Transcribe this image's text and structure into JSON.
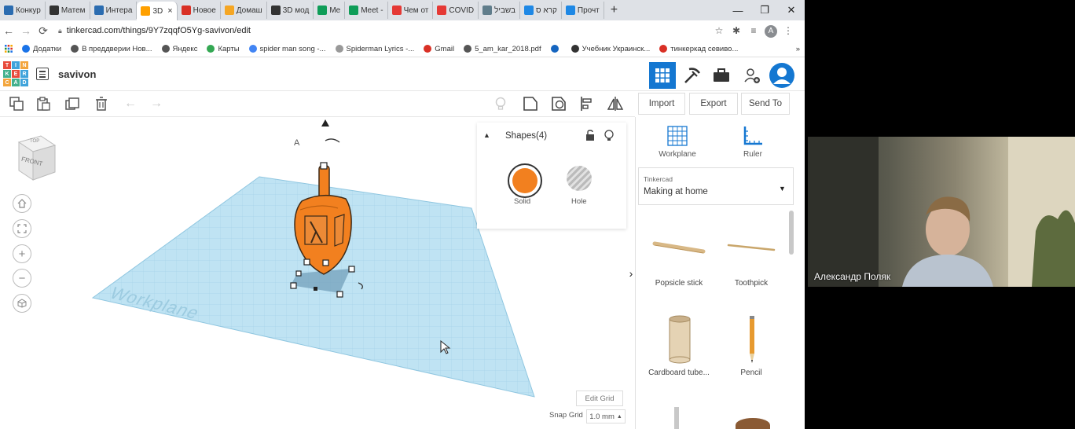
{
  "browser": {
    "tabs": [
      {
        "label": "Конкур",
        "icon_color": "#2b6cb0"
      },
      {
        "label": "Матем",
        "icon_color": "#333333"
      },
      {
        "label": "Интера",
        "icon_color": "#2b6cb0"
      },
      {
        "label": "3D",
        "icon_color": "#ffa000",
        "active": true
      },
      {
        "label": "Новое",
        "icon_color": "#d93025"
      },
      {
        "label": "Домаш",
        "icon_color": "#f5a623"
      },
      {
        "label": "3D мод",
        "icon_color": "#333333"
      },
      {
        "label": "Me",
        "icon_color": "#0f9d58"
      },
      {
        "label": "Meet -",
        "icon_color": "#0f9d58"
      },
      {
        "label": "Чем от",
        "icon_color": "#e53935"
      },
      {
        "label": "COVID",
        "icon_color": "#e53935"
      },
      {
        "label": "בשביל",
        "icon_color": "#607d8b"
      },
      {
        "label": "קרא ס",
        "icon_color": "#1e88e5"
      },
      {
        "label": "Прочт",
        "icon_color": "#1e88e5"
      }
    ],
    "new_tab": "+",
    "close_tab": "×",
    "url": "tinkercad.com/things/9Y7zqqfO5Yg-savivon/edit",
    "profile_initial": "A",
    "bookmarks": [
      {
        "label": "Додатки",
        "icon_color": "#1a73e8"
      },
      {
        "label": "В преддверии Нов...",
        "icon_color": "#555555"
      },
      {
        "label": "Яндекс",
        "icon_color": "#555555"
      },
      {
        "label": "Карты",
        "icon_color": "#34a853"
      },
      {
        "label": "spider man song -...",
        "icon_color": "#4285f4"
      },
      {
        "label": "Spiderman Lyrics -...",
        "icon_color": "#999999"
      },
      {
        "label": "Gmail",
        "icon_color": "#d93025"
      },
      {
        "label": "5_am_kar_2018.pdf",
        "icon_color": "#555555"
      },
      {
        "label": "",
        "icon_color": "#1565c0"
      },
      {
        "label": "Учебник Украинск...",
        "icon_color": "#333333"
      },
      {
        "label": "тинкеркад севиво...",
        "icon_color": "#d93025"
      }
    ],
    "more_bookmarks": "»"
  },
  "app": {
    "logo_letters": [
      "T",
      "I",
      "N",
      "K",
      "E",
      "R",
      "C",
      "A",
      "D"
    ],
    "design_name": "savivon",
    "accent_color": "#1477d1",
    "import_label": "Import",
    "export_label": "Export",
    "send_to_label": "Send To"
  },
  "viewcube": {
    "top_label": "TOP",
    "front_label": "FRONT"
  },
  "workplane_label": "Workplane",
  "shapes_panel": {
    "title": "Shapes(4)",
    "solid_label": "Solid",
    "hole_label": "Hole",
    "solid_color": "#f2801f"
  },
  "sidepanel": {
    "workplane_label": "Workplane",
    "ruler_label": "Ruler",
    "library_category": "Tinkercad",
    "library_selected": "Making at home",
    "items": [
      {
        "label": "Popsicle stick"
      },
      {
        "label": "Toothpick"
      },
      {
        "label": "Cardboard tube..."
      },
      {
        "label": "Pencil"
      }
    ]
  },
  "footer": {
    "edit_grid": "Edit Grid",
    "snap_grid_label": "Snap Grid",
    "snap_grid_value": "1.0 mm"
  },
  "video": {
    "participant_name": "Александр Поляк"
  }
}
